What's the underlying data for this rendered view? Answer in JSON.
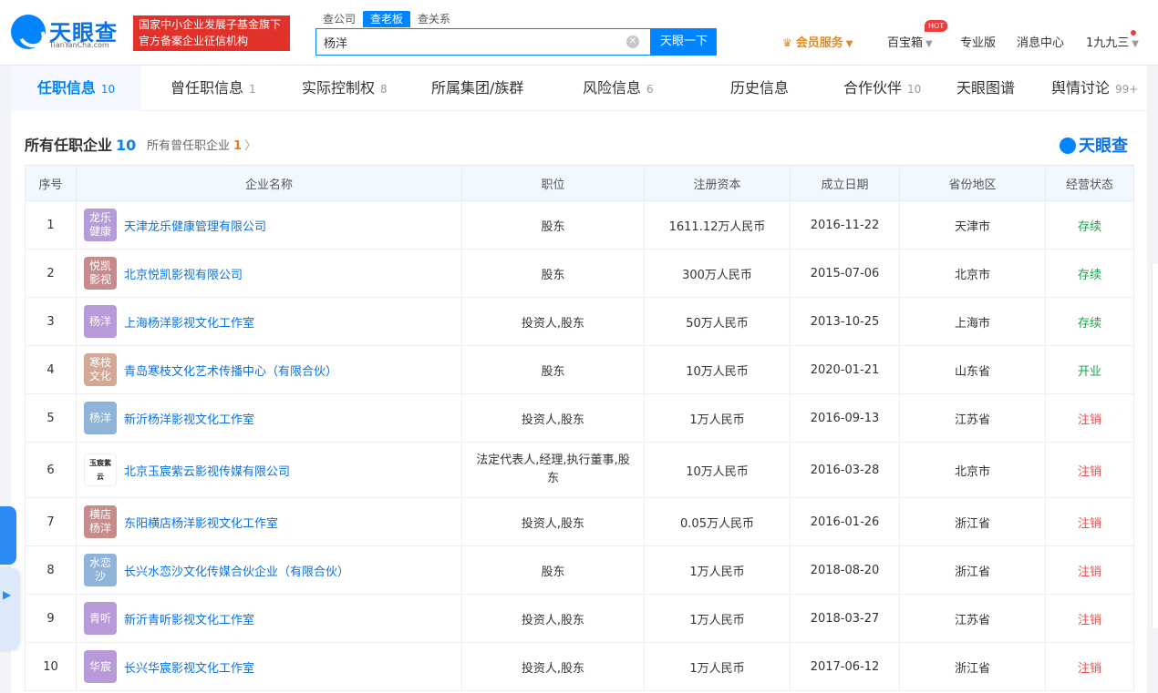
{
  "header": {
    "logo_text": "天眼查",
    "logo_sub": "TianYanCha.com",
    "gov_line1": "国家中小企业发展子基金旗下",
    "gov_line2": "官方备案企业征信机构",
    "search_tabs": [
      "查公司",
      "查老板",
      "查关系"
    ],
    "active_search_tab": "查老板",
    "search_value": "杨洋",
    "search_button": "天眼一下",
    "vip": "会员服务",
    "toolbox": "百宝箱",
    "hot_badge": "HOT",
    "pro": "专业版",
    "messages": "消息中心",
    "user": "1九九三"
  },
  "tabs": [
    {
      "label": "任职信息",
      "count": "10"
    },
    {
      "label": "曾任职信息",
      "count": "1"
    },
    {
      "label": "实际控制权",
      "count": "8"
    },
    {
      "label": "所属集团/族群",
      "count": ""
    },
    {
      "label": "风险信息",
      "count": "6"
    },
    {
      "label": "历史信息",
      "count": ""
    },
    {
      "label": "合作伙伴",
      "count": "10"
    },
    {
      "label": "天眼图谱",
      "count": ""
    },
    {
      "label": "舆情讨论",
      "count": "99+"
    }
  ],
  "section": {
    "title": "所有任职企业",
    "count": "10",
    "sub_label": "所有曾任职企业",
    "sub_count": "1",
    "watermark": "天眼查"
  },
  "table": {
    "columns": [
      "序号",
      "企业名称",
      "职位",
      "注册资本",
      "成立日期",
      "省份地区",
      "经营状态"
    ],
    "rows": [
      {
        "idx": "1",
        "logo": "龙乐健康",
        "logo_color": "#b79ad8",
        "name": "天津龙乐健康管理有限公司",
        "role": "股东",
        "capital": "1611.12万人民币",
        "date": "2016-11-22",
        "region": "天津市",
        "status": "存续",
        "status_color": "green"
      },
      {
        "idx": "2",
        "logo": "悦凯影视",
        "logo_color": "#c88b8b",
        "name": "北京悦凯影视有限公司",
        "role": "股东",
        "capital": "300万人民币",
        "date": "2015-07-06",
        "region": "北京市",
        "status": "存续",
        "status_color": "green"
      },
      {
        "idx": "3",
        "logo": "杨洋",
        "logo_color": "#b79ad8",
        "name": "上海杨洋影视文化工作室",
        "role": "投资人,股东",
        "capital": "50万人民币",
        "date": "2013-10-25",
        "region": "上海市",
        "status": "存续",
        "status_color": "green"
      },
      {
        "idx": "4",
        "logo": "寒枝文化",
        "logo_color": "#d3a896",
        "name": "青岛寒枝文化艺术传播中心（有限合伙）",
        "role": "股东",
        "capital": "10万人民币",
        "date": "2020-01-21",
        "region": "山东省",
        "status": "开业",
        "status_color": "green"
      },
      {
        "idx": "5",
        "logo": "杨洋",
        "logo_color": "#8fb3d9",
        "name": "新沂杨洋影视文化工作室",
        "role": "投资人,股东",
        "capital": "1万人民币",
        "date": "2016-09-13",
        "region": "江苏省",
        "status": "注销",
        "status_color": "red"
      },
      {
        "idx": "6",
        "logo": "玉宸紫云",
        "logo_color": "#ffffff",
        "name": "北京玉宸紫云影视传媒有限公司",
        "role": "法定代表人,经理,执行董事,股东",
        "capital": "10万人民币",
        "date": "2016-03-28",
        "region": "北京市",
        "status": "注销",
        "status_color": "red"
      },
      {
        "idx": "7",
        "logo": "横店杨洋",
        "logo_color": "#c88b8b",
        "name": "东阳横店杨洋影视文化工作室",
        "role": "投资人,股东",
        "capital": "0.05万人民币",
        "date": "2016-01-26",
        "region": "浙江省",
        "status": "注销",
        "status_color": "red"
      },
      {
        "idx": "8",
        "logo": "水恋沙",
        "logo_color": "#8fb3d9",
        "name": "长兴水恋沙文化传媒合伙企业（有限合伙）",
        "role": "股东",
        "capital": "1万人民币",
        "date": "2018-08-20",
        "region": "浙江省",
        "status": "注销",
        "status_color": "red"
      },
      {
        "idx": "9",
        "logo": "青听",
        "logo_color": "#b79ad8",
        "name": "新沂青听影视文化工作室",
        "role": "投资人,股东",
        "capital": "1万人民币",
        "date": "2018-03-27",
        "region": "江苏省",
        "status": "注销",
        "status_color": "red"
      },
      {
        "idx": "10",
        "logo": "华宸",
        "logo_color": "#b79ad8",
        "name": "长兴华宸影视文化工作室",
        "role": "投资人,股东",
        "capital": "1万人民币",
        "date": "2017-06-12",
        "region": "浙江省",
        "status": "注销",
        "status_color": "red"
      }
    ]
  }
}
